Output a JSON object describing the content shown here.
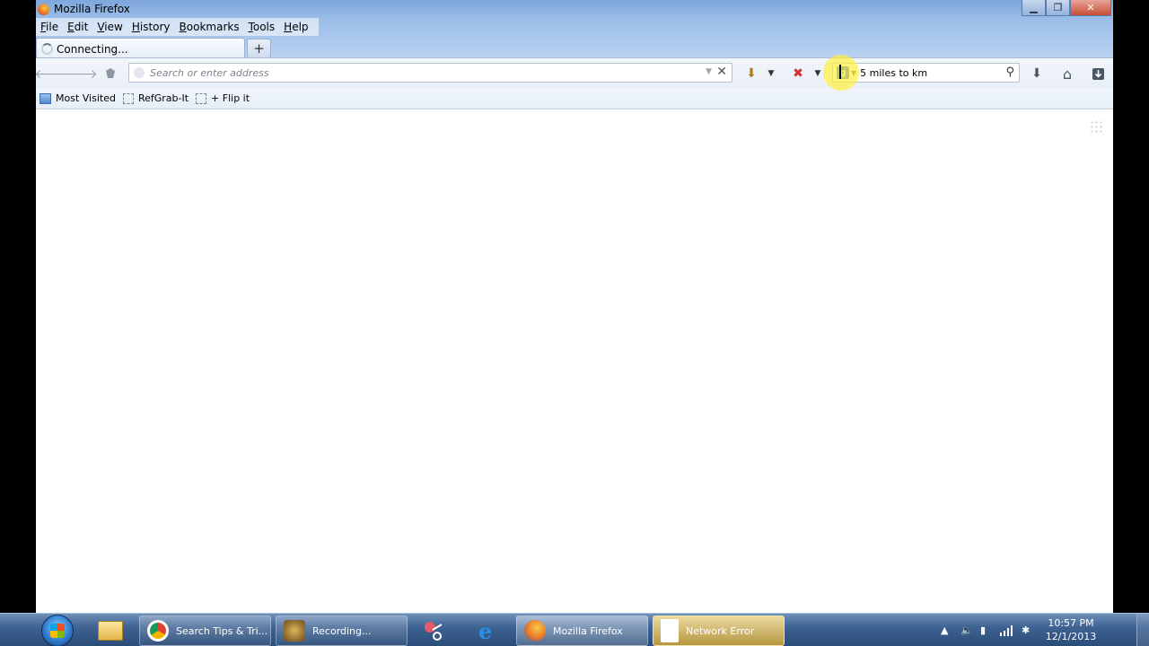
{
  "window": {
    "title": "Mozilla Firefox",
    "caption_min": "▁",
    "caption_max": "❐",
    "caption_close": "✕"
  },
  "menu": [
    {
      "label": "File",
      "u": "F",
      "rest": "ile"
    },
    {
      "label": "Edit",
      "u": "E",
      "rest": "dit"
    },
    {
      "label": "View",
      "u": "V",
      "rest": "iew"
    },
    {
      "label": "History",
      "u": "H",
      "rest": "istory"
    },
    {
      "label": "Bookmarks",
      "u": "B",
      "rest": "ookmarks"
    },
    {
      "label": "Tools",
      "u": "T",
      "rest": "ools"
    },
    {
      "label": "Help",
      "u": "H",
      "rest": "elp"
    }
  ],
  "tab": {
    "label": "Connecting...",
    "new_tab": "+"
  },
  "navbar": {
    "back": "🡐",
    "forward": "🡒",
    "url_placeholder": "Search or enter address",
    "url_value": "",
    "url_clear": "✕",
    "search_value": "5 miles to km",
    "search_engine": "g",
    "search_magnifier": "⚲"
  },
  "bookmarks": [
    {
      "label": "Most Visited",
      "icon": "most-visited-icon"
    },
    {
      "label": "RefGrab-It",
      "icon": "bookmark-folder-icon"
    },
    {
      "label": "+ Flip it",
      "icon": "bookmark-folder-icon"
    }
  ],
  "taskbar": {
    "tasks": [
      {
        "label": "Search Tips & Tri...",
        "icon": "chrome-icon"
      },
      {
        "label": "Recording...",
        "icon": "recording-icon"
      },
      {
        "label": "Mozilla Firefox",
        "icon": "firefox-icon"
      },
      {
        "label": "Network Error",
        "icon": "document-icon"
      }
    ],
    "clock_time": "10:57 PM",
    "clock_date": "12/1/2013"
  },
  "colors": {
    "titlebar": "#9fc0ea",
    "taskbar": "#3f6393",
    "highlight": "#fff03c"
  }
}
